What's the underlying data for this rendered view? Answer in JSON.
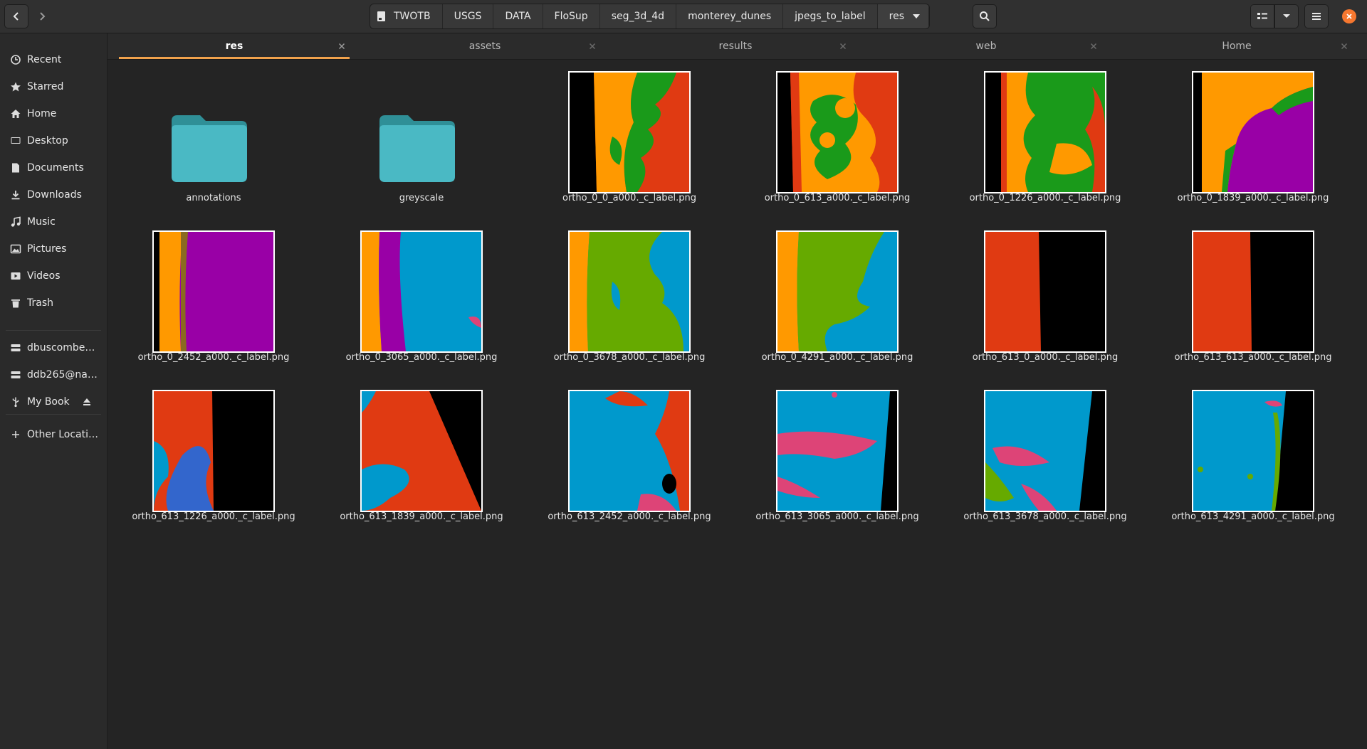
{
  "window": {
    "accent_color": "#f1a24c",
    "close_color": "#f6772f"
  },
  "path": [
    "TWOTB",
    "USGS",
    "DATA",
    "FloSup",
    "seg_3d_4d",
    "monterey_dunes",
    "jpegs_to_label",
    "res"
  ],
  "sidebar": {
    "places": [
      {
        "label": "Recent",
        "icon": "clock-icon"
      },
      {
        "label": "Starred",
        "icon": "star-icon"
      },
      {
        "label": "Home",
        "icon": "home-icon"
      },
      {
        "label": "Desktop",
        "icon": "desktop-icon"
      },
      {
        "label": "Documents",
        "icon": "document-icon"
      },
      {
        "label": "Downloads",
        "icon": "download-icon"
      },
      {
        "label": "Music",
        "icon": "music-icon"
      },
      {
        "label": "Pictures",
        "icon": "picture-icon"
      },
      {
        "label": "Videos",
        "icon": "video-icon"
      },
      {
        "label": "Trash",
        "icon": "trash-icon"
      }
    ],
    "devices": [
      {
        "label": "dbuscombe@...",
        "icon": "network-drive-icon"
      },
      {
        "label": "ddb265@nau....",
        "icon": "network-drive-icon"
      },
      {
        "label": "My Book",
        "icon": "usb-icon"
      }
    ],
    "other": {
      "label": "Other Locations",
      "icon": "plus-icon"
    }
  },
  "tabs": [
    {
      "label": "res",
      "active": true
    },
    {
      "label": "assets",
      "active": false
    },
    {
      "label": "results",
      "active": false
    },
    {
      "label": "web",
      "active": false
    },
    {
      "label": "Home",
      "active": false
    }
  ],
  "files": [
    {
      "name": "annotations",
      "type": "folder"
    },
    {
      "name": "greyscale",
      "type": "folder"
    },
    {
      "name": "ortho_0_0_a000._c_label.png",
      "type": "image",
      "colors": [
        "#000000",
        "#ff9900",
        "#1a9a1a",
        "#e03a12"
      ]
    },
    {
      "name": "ortho_0_613_a000._c_label.png",
      "type": "image",
      "colors": [
        "#000000",
        "#ff9900",
        "#1a9a1a",
        "#e03a12"
      ]
    },
    {
      "name": "ortho_0_1226_a000._c_label.png",
      "type": "image",
      "colors": [
        "#000000",
        "#ff9900",
        "#1a9a1a",
        "#e03a12"
      ]
    },
    {
      "name": "ortho_0_1839_a000._c_label.png",
      "type": "image",
      "colors": [
        "#000000",
        "#ff9900",
        "#1a9a1a",
        "#9900a6"
      ]
    },
    {
      "name": "ortho_0_2452_a000._c_label.png",
      "type": "image",
      "colors": [
        "#000000",
        "#ff9900",
        "#9900a6"
      ]
    },
    {
      "name": "ortho_0_3065_a000._c_label.png",
      "type": "image",
      "colors": [
        "#ff9900",
        "#9900a6",
        "#0099cc"
      ]
    },
    {
      "name": "ortho_0_3678_a000._c_label.png",
      "type": "image",
      "colors": [
        "#ff9900",
        "#66aa00",
        "#0099cc"
      ]
    },
    {
      "name": "ortho_0_4291_a000._c_label.png",
      "type": "image",
      "colors": [
        "#ff9900",
        "#66aa00",
        "#0099cc"
      ]
    },
    {
      "name": "ortho_613_0_a000._c_label.png",
      "type": "image",
      "colors": [
        "#e03a12",
        "#000000"
      ]
    },
    {
      "name": "ortho_613_613_a000._c_label.png",
      "type": "image",
      "colors": [
        "#e03a12",
        "#000000"
      ]
    },
    {
      "name": "ortho_613_1226_a000._c_label.png",
      "type": "image",
      "colors": [
        "#e03a12",
        "#3366cc",
        "#000000"
      ]
    },
    {
      "name": "ortho_613_1839_a000._c_label.png",
      "type": "image",
      "colors": [
        "#0099cc",
        "#e03a12",
        "#000000"
      ]
    },
    {
      "name": "ortho_613_2452_a000._c_label.png",
      "type": "image",
      "colors": [
        "#0099cc",
        "#e03a12",
        "#dd4477"
      ]
    },
    {
      "name": "ortho_613_3065_a000._c_label.png",
      "type": "image",
      "colors": [
        "#0099cc",
        "#dd4477",
        "#000000"
      ]
    },
    {
      "name": "ortho_613_3678_a000._c_label.png",
      "type": "image",
      "colors": [
        "#0099cc",
        "#dd4477",
        "#66aa00",
        "#000000"
      ]
    },
    {
      "name": "ortho_613_4291_a000._c_label.png",
      "type": "image",
      "colors": [
        "#0099cc",
        "#66aa00",
        "#dd4477",
        "#000000"
      ]
    }
  ]
}
